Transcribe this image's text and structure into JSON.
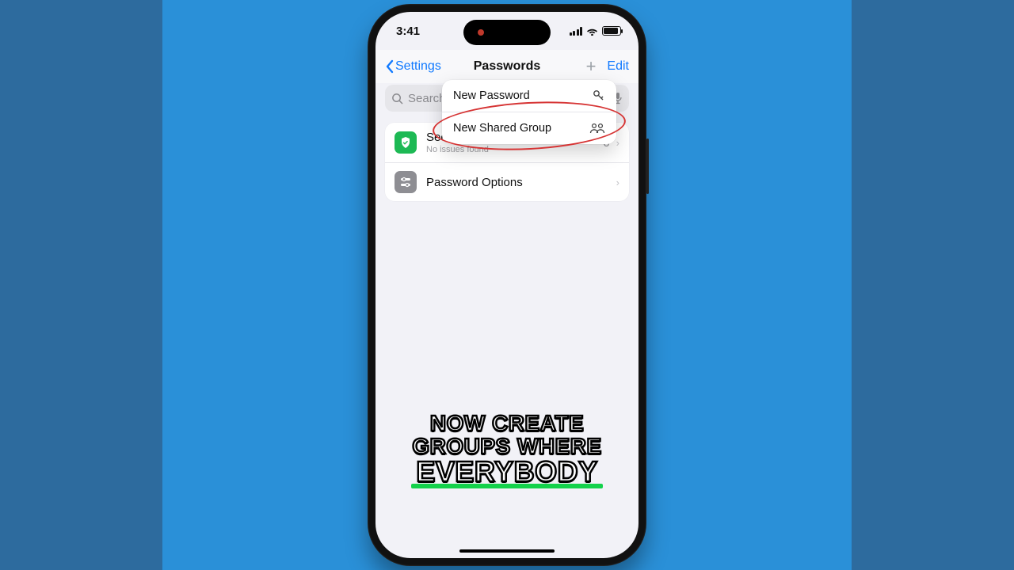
{
  "status": {
    "time": "3:41"
  },
  "nav": {
    "back_label": "Settings",
    "title": "Passwords",
    "edit_label": "Edit",
    "plus_label": "+"
  },
  "search": {
    "placeholder": "Search"
  },
  "popup": {
    "items": [
      {
        "label": "New Password",
        "icon": "key-icon"
      },
      {
        "label": "New Shared Group",
        "icon": "people-icon"
      }
    ]
  },
  "list": {
    "items": [
      {
        "label": "Security Recommendations",
        "sub": "No issues found",
        "count": "0",
        "icon": "shield-icon"
      },
      {
        "label": "Password Options",
        "sub": "",
        "count": "",
        "icon": "options-icon"
      }
    ]
  },
  "caption": {
    "line1": "NOW CREATE",
    "line2": "GROUPS WHERE",
    "line3": "EVERYBODY"
  }
}
